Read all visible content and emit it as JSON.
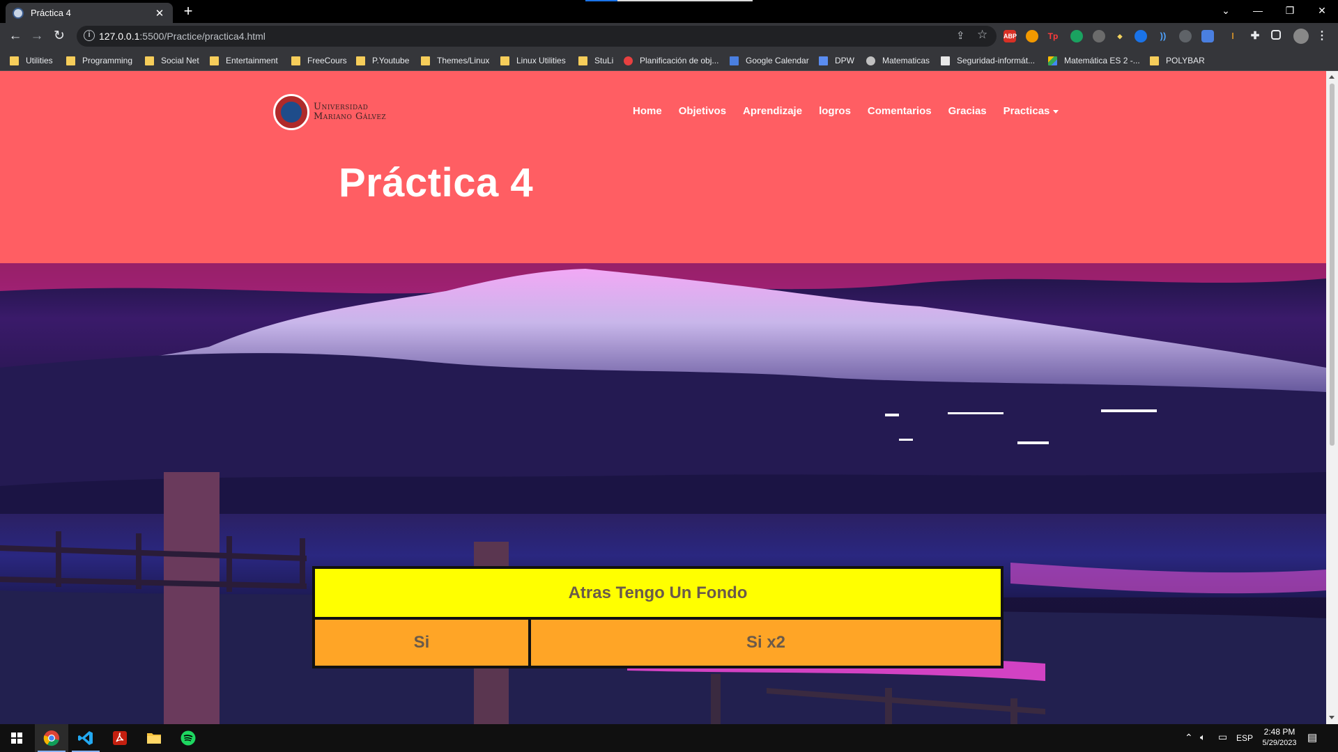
{
  "browser": {
    "tab_title": "Práctica 4",
    "url_host": "127.0.0.1",
    "url_rest": ":5500/Practice/practica4.html",
    "bookmarks": [
      {
        "label": "Utilities",
        "icon": "folder-icon"
      },
      {
        "label": "Programming",
        "icon": "folder-icon"
      },
      {
        "label": "Social Net",
        "icon": "folder-icon"
      },
      {
        "label": "Entertainment",
        "icon": "folder-icon"
      },
      {
        "label": "FreeCours",
        "icon": "folder-icon"
      },
      {
        "label": "P.Youtube",
        "icon": "folder-icon"
      },
      {
        "label": "Themes/Linux",
        "icon": "folder-icon"
      },
      {
        "label": "Linux Utilities",
        "icon": "folder-icon"
      },
      {
        "label": "StuLi",
        "icon": "folder-icon"
      },
      {
        "label": "Planificación de obj...",
        "icon": "target-icon"
      },
      {
        "label": "Google Calendar",
        "icon": "calendar-icon"
      },
      {
        "label": "DPW",
        "icon": "docs-icon"
      },
      {
        "label": "Matematicas",
        "icon": "globe-icon"
      },
      {
        "label": "Seguridad-informát...",
        "icon": "page-icon"
      },
      {
        "label": "Matemática ES 2 -...",
        "icon": "drive-icon"
      },
      {
        "label": "POLYBAR",
        "icon": "folder-icon"
      }
    ]
  },
  "site": {
    "logo_line1": "Universidad",
    "logo_line2": "Mariano Gálvez",
    "nav": [
      "Home",
      "Objetivos",
      "Aprendizaje",
      "logros",
      "Comentarios",
      "Gracias",
      "Practicas"
    ],
    "page_title": "Práctica 4"
  },
  "table": {
    "header": "Atras Tengo Un Fondo",
    "cell_a": "Si",
    "cell_b": "Si x2"
  },
  "taskbar": {
    "language": "ESP",
    "time": "2:48 PM",
    "date": "5/29/2023"
  },
  "colors": {
    "header_bg": "#ff5e63",
    "table_header_bg": "#ffff00",
    "table_cell_bg": "#ffa526"
  }
}
